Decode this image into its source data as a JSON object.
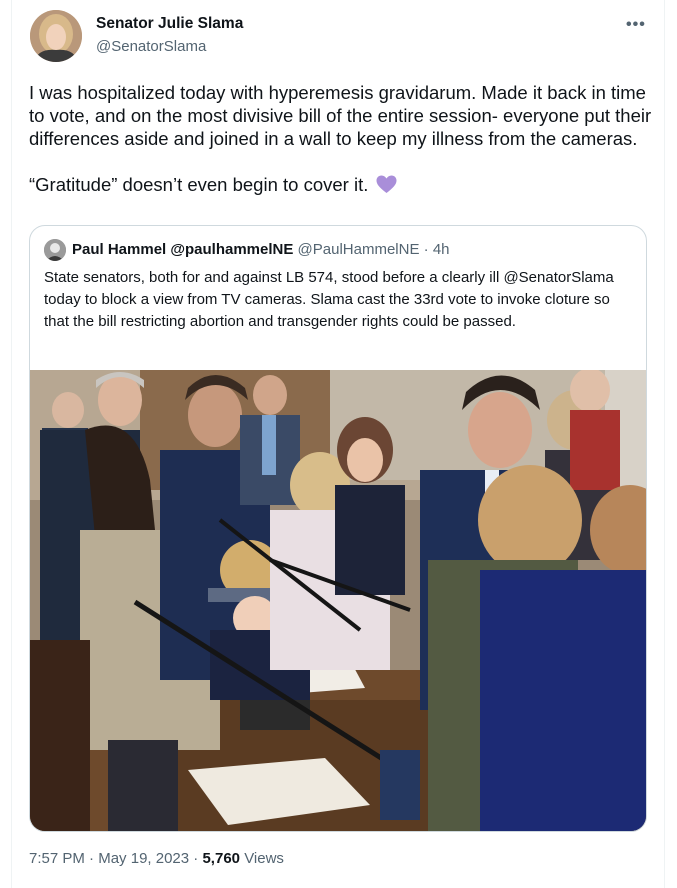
{
  "author": {
    "display_name": "Senator Julie Slama",
    "handle": "@SenatorSlama",
    "avatar_icon": "profile-photo"
  },
  "more_icon": "more-options-icon",
  "tweet": {
    "paragraph1": "I was hospitalized today with hyperemesis gravidarum. Made it back in time to vote, and on the most divisive bill of the entire session- everyone put their differences aside and joined in a wall to keep my illness from the cameras.",
    "paragraph2": "“Gratitude” doesn’t even begin to cover it.",
    "emoji": "purple-heart",
    "emoji_color": "#a98ed9"
  },
  "quoted": {
    "name": "Paul Hammel @paulhammelNE",
    "handle": "@PaulHammelNE",
    "separator": "·",
    "time": "4h",
    "text": "State senators, both for and against LB 574, stood before a clearly ill @SenatorSlama  today to block a view from TV cameras. Slama cast the 33rd vote to invoke cloture so that the bill restricting abortion and transgender rights could be passed."
  },
  "meta": {
    "time": "7:57 PM",
    "sep1": "·",
    "date": "May 19, 2023",
    "sep2": "·",
    "views_count": "5,760",
    "views_label": "Views"
  }
}
